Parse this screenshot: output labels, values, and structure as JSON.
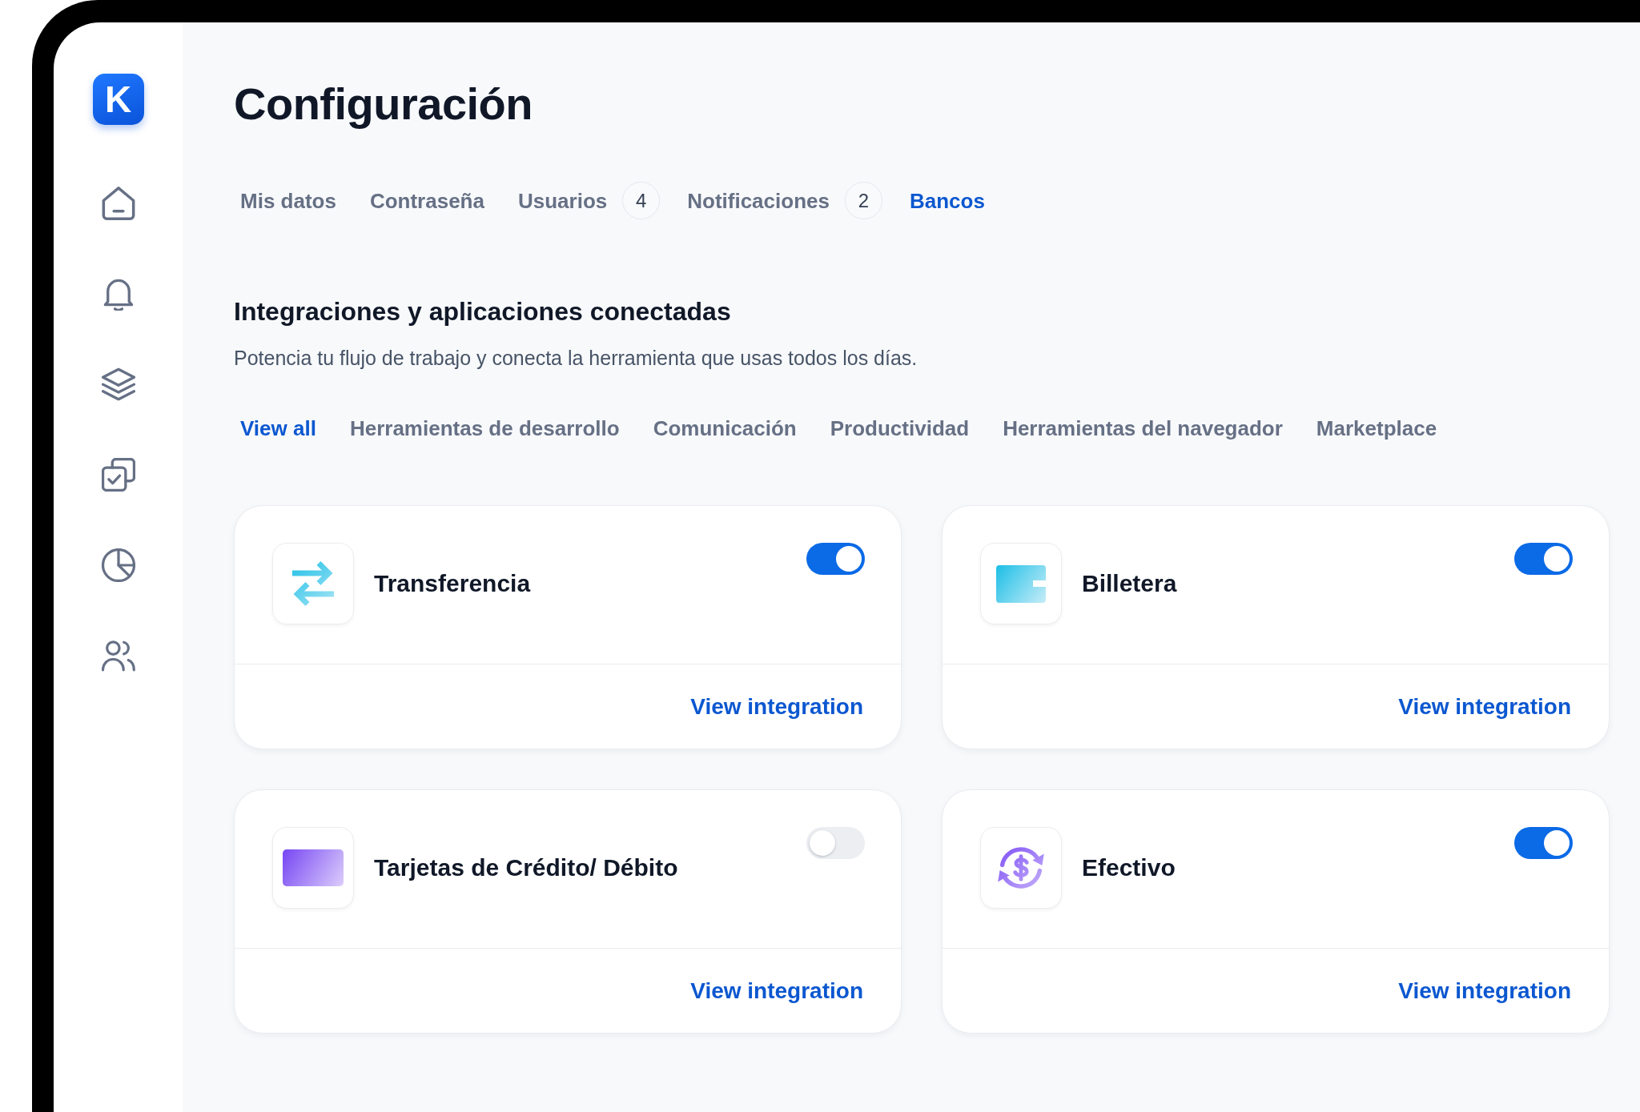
{
  "sidebar": {
    "logo": "K"
  },
  "page": {
    "title": "Configuración"
  },
  "tabs": [
    {
      "label": "Mis datos",
      "selected": false
    },
    {
      "label": "Contraseña",
      "selected": false
    },
    {
      "label": "Usuarios",
      "selected": false,
      "badge": "4"
    },
    {
      "label": "Notificaciones",
      "selected": false,
      "badge": "2"
    },
    {
      "label": "Bancos",
      "selected": true
    }
  ],
  "integrations": {
    "heading": "Integraciones y aplicaciones conectadas",
    "description": "Potencia tu flujo de trabajo y conecta la herramienta que usas todos los días.",
    "filters": [
      {
        "label": "View all",
        "selected": true
      },
      {
        "label": "Herramientas de desarrollo",
        "selected": false
      },
      {
        "label": "Comunicación",
        "selected": false
      },
      {
        "label": "Productividad",
        "selected": false
      },
      {
        "label": "Herramientas del navegador",
        "selected": false
      },
      {
        "label": "Marketplace",
        "selected": false
      }
    ],
    "cards": [
      {
        "kind": "transfer",
        "title": "Transferencia",
        "on": true,
        "link": "View integration"
      },
      {
        "kind": "wallet",
        "title": "Billetera",
        "on": true,
        "link": "View integration"
      },
      {
        "kind": "card",
        "title": "Tarjetas de Crédito/ Débito",
        "on": false,
        "link": "View integration"
      },
      {
        "kind": "cash",
        "title": "Efectivo",
        "on": true,
        "link": "View integration"
      }
    ]
  }
}
